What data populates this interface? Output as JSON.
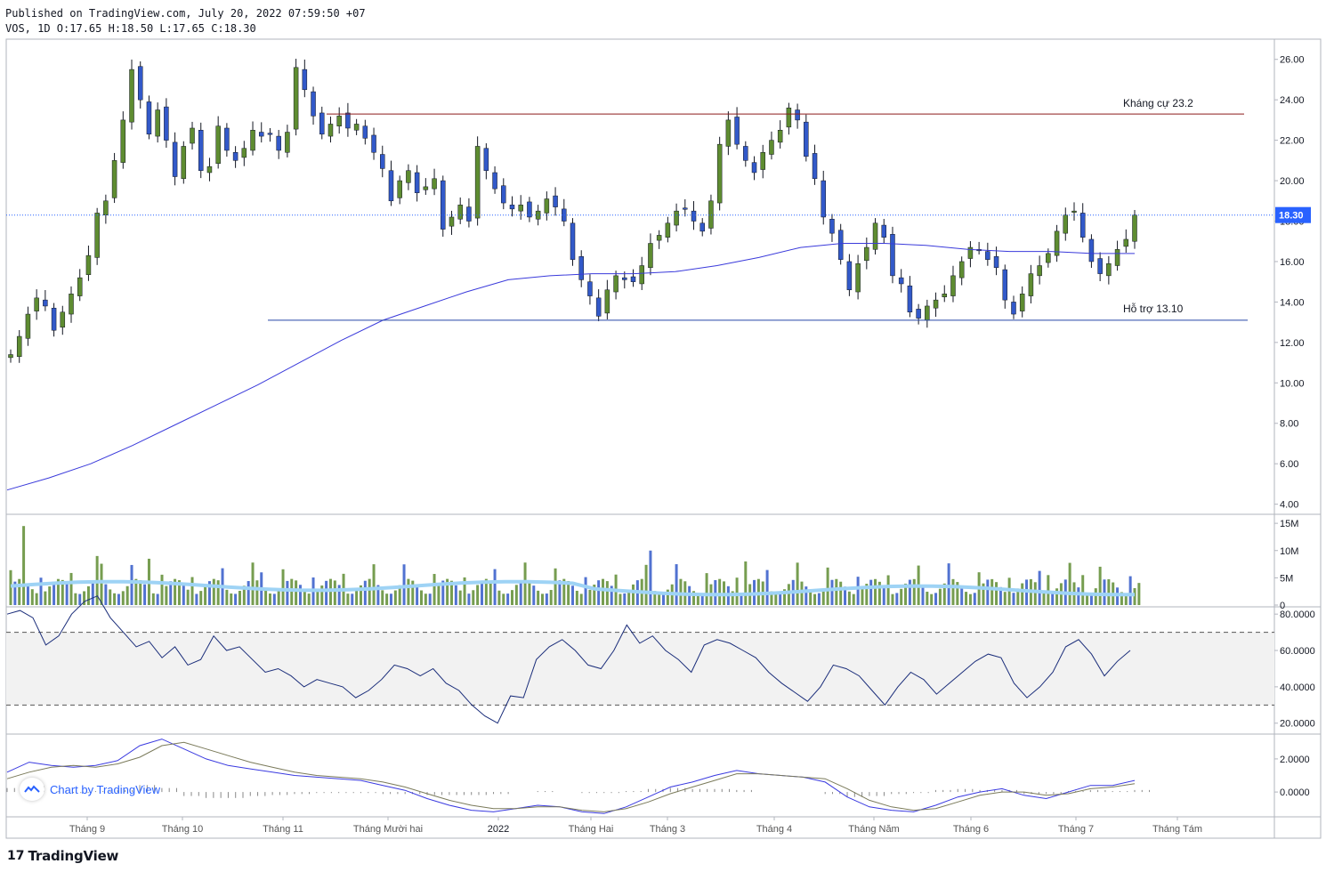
{
  "header": {
    "published": "Published on TradingView.com, July 20, 2022 07:59:50 +07",
    "ohlc": "VOS, 1D O:17.65 H:18.50 L:17.65 C:18.30"
  },
  "footer": {
    "logo_mark": "17",
    "brand": "TradingView"
  },
  "watermark": {
    "text": "Chart by TradingView"
  },
  "colors": {
    "up": "#5e8c31",
    "down": "#3259c9",
    "ma": "#3a3adb",
    "resistance": "#8b1a1a",
    "support": "#2848a8",
    "volume_ma": "#9ed3f5",
    "rsi": "#1a2d7a",
    "macd": "#3a3ae0",
    "signal": "#7a7a5a",
    "price_badge": "#2962ff"
  },
  "chart_data": [
    {
      "type": "candlestick",
      "title": "VOS, 1D",
      "ylim": [
        3.5,
        27.0
      ],
      "yticks": [
        "26.00",
        "24.00",
        "22.00",
        "20.00",
        "18.00",
        "16.00",
        "14.00",
        "12.00",
        "10.00",
        "8.00",
        "6.00",
        "4.00"
      ],
      "x_labels": [
        "Tháng 9",
        "Tháng 10",
        "Tháng 11",
        "Tháng Mười hai",
        "2022",
        "Tháng Hai",
        "Tháng 3",
        "Tháng 4",
        "Tháng Năm",
        "Tháng 6",
        "Tháng 7",
        "Tháng Tám"
      ],
      "last_price": "18.30",
      "annotations": [
        {
          "text": "Kháng cự 23.2",
          "value": 23.3
        },
        {
          "text": "Hỗ trợ 13.10",
          "value": 13.1
        }
      ],
      "close_trajectory": [
        11.4,
        12.3,
        13.4,
        14.2,
        13.8,
        12.6,
        13.5,
        14.4,
        15.2,
        16.3,
        18.4,
        19.0,
        21.0,
        23.0,
        25.5,
        24.0,
        22.3,
        23.5,
        22.0,
        20.2,
        21.7,
        22.6,
        20.5,
        20.7,
        22.7,
        21.5,
        21.0,
        21.6,
        22.5,
        22.2,
        22.3,
        21.5,
        22.4,
        25.6,
        24.5,
        23.2,
        22.3,
        22.8,
        23.2,
        22.6,
        22.8,
        22.1,
        21.4,
        20.6,
        19.0,
        20.0,
        20.5,
        19.4,
        19.7,
        20.1,
        17.6,
        18.2,
        18.8,
        18.0,
        21.7,
        20.5,
        19.6,
        18.9,
        18.6,
        18.8,
        18.2,
        18.5,
        19.1,
        18.7,
        18.0,
        16.1,
        15.1,
        14.3,
        13.3,
        14.6,
        15.3,
        15.1,
        15.0,
        15.8,
        16.9,
        17.3,
        17.9,
        18.5,
        18.6,
        18.0,
        17.5,
        19.0,
        21.8,
        23.0,
        21.8,
        21.0,
        20.4,
        21.4,
        22.0,
        22.5,
        23.6,
        23.0,
        21.2,
        20.1,
        18.2,
        17.4,
        16.1,
        14.6,
        15.9,
        16.7,
        17.9,
        17.2,
        15.3,
        14.9,
        13.5,
        13.2,
        13.8,
        14.1,
        14.4,
        15.3,
        16.0,
        16.7,
        16.6,
        16.1,
        15.7,
        14.1,
        13.4,
        14.4,
        15.4,
        15.8,
        16.4,
        17.5,
        18.3,
        18.5,
        17.2,
        16.0,
        15.4,
        15.9,
        16.6,
        17.1,
        18.3
      ],
      "ma_line": [
        4.7,
        5.3,
        6.0,
        6.9,
        7.9,
        8.9,
        9.9,
        11.0,
        12.1,
        13.1,
        13.8,
        14.5,
        15.1,
        15.3,
        15.4,
        15.4,
        15.5,
        15.8,
        16.2,
        16.7,
        16.9,
        16.9,
        16.8,
        16.6,
        16.5,
        16.5,
        16.4,
        16.4
      ]
    },
    {
      "type": "bar",
      "title": "Volume",
      "yticks": [
        "15M",
        "10M",
        "5M",
        "0"
      ],
      "ylim": [
        0,
        16
      ],
      "volume_ma_level": 3.5
    },
    {
      "type": "line",
      "title": "RSI",
      "yticks": [
        "80.0000",
        "60.0000",
        "40.0000",
        "20.0000"
      ],
      "ylim": [
        14,
        84
      ],
      "bands": [
        70,
        30
      ],
      "values": [
        80,
        82,
        78,
        63,
        68,
        80,
        87,
        90,
        78,
        70,
        62,
        65,
        56,
        62,
        52,
        55,
        68,
        60,
        62,
        55,
        48,
        50,
        46,
        40,
        44,
        42,
        40,
        34,
        38,
        44,
        52,
        50,
        46,
        50,
        42,
        38,
        30,
        24,
        20,
        35,
        34,
        55,
        62,
        66,
        60,
        52,
        50,
        60,
        74,
        64,
        68,
        60,
        55,
        48,
        63,
        66,
        64,
        60,
        56,
        48,
        42,
        37,
        32,
        40,
        52,
        50,
        46,
        38,
        30,
        40,
        48,
        44,
        36,
        42,
        48,
        54,
        58,
        56,
        42,
        34,
        40,
        48,
        62,
        66,
        58,
        46,
        54,
        60
      ]
    },
    {
      "type": "line",
      "title": "MACD",
      "yticks": [
        "2.0000",
        "0.0000"
      ],
      "ylim": [
        -1.5,
        3.5
      ],
      "macd": [
        1.2,
        1.8,
        1.6,
        1.5,
        1.6,
        1.9,
        2.8,
        3.2,
        2.6,
        2.0,
        1.6,
        1.4,
        1.2,
        1.0,
        0.9,
        0.8,
        0.7,
        0.4,
        0.1,
        -0.4,
        -0.8,
        -1.1,
        -1.2,
        -1.0,
        -0.8,
        -0.9,
        -1.2,
        -1.3,
        -0.9,
        -0.3,
        0.3,
        0.6,
        1.0,
        1.3,
        1.1,
        1.0,
        0.9,
        0.6,
        -0.3,
        -0.9,
        -1.1,
        -1.2,
        -0.8,
        -0.3,
        0.0,
        0.2,
        -0.2,
        -0.4,
        0.0,
        0.4,
        0.4,
        0.7
      ],
      "signal": [
        0.8,
        1.2,
        1.5,
        1.6,
        1.5,
        1.7,
        2.1,
        2.8,
        3.0,
        2.6,
        2.2,
        1.8,
        1.5,
        1.2,
        1.0,
        0.9,
        0.8,
        0.6,
        0.3,
        -0.1,
        -0.5,
        -0.8,
        -1.0,
        -1.0,
        -0.9,
        -0.9,
        -1.1,
        -1.2,
        -1.0,
        -0.6,
        -0.1,
        0.3,
        0.7,
        1.1,
        1.1,
        1.0,
        0.9,
        0.8,
        0.2,
        -0.5,
        -0.9,
        -1.1,
        -1.0,
        -0.6,
        -0.2,
        0.0,
        0.0,
        -0.2,
        -0.1,
        0.2,
        0.3,
        0.5
      ]
    }
  ]
}
